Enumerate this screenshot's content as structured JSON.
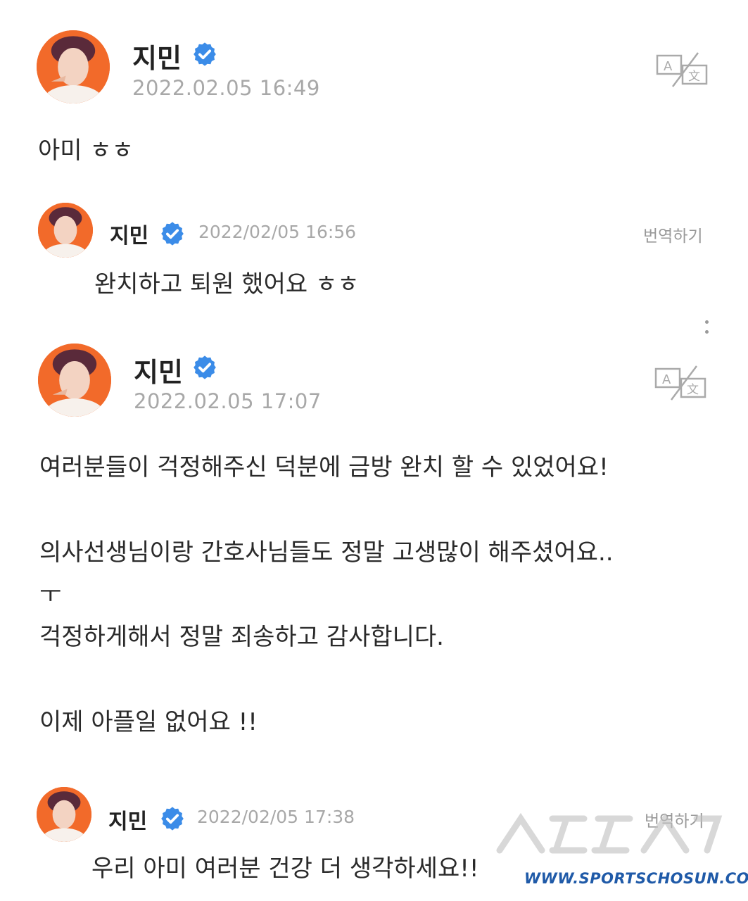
{
  "posts": [
    {
      "author": "지민",
      "date": "2022.02.05 16:49",
      "body": "아미 ㅎㅎ"
    },
    {
      "author": "지민",
      "date": "2022.02.05 17:07",
      "body_lines": [
        "여러분들이 걱정해주신 덕분에 금방 완치 할 수 있었어요!",
        "의사선생님이랑 간호사님들도 정말 고생많이 해주셨어요..",
        "ㅜ",
        "걱정하게해서 정말 죄송하고 감사합니다.",
        "이제 아플일 없어요 !!"
      ]
    }
  ],
  "comments": [
    {
      "author": "지민",
      "date": "2022/02/05 16:56",
      "translate_label": "번역하기",
      "body": "완치하고 퇴원 했어요 ㅎㅎ"
    },
    {
      "author": "지민",
      "date": "2022/02/05 17:38",
      "translate_label": "번역하기",
      "body": "우리 아미 여러분 건강 더 생각하세요!!"
    }
  ],
  "watermark": {
    "url": "WWW.SPORTSCHOSUN.COM"
  },
  "colors": {
    "verified": "#3b8ce8",
    "avatar_bg": "#f36b2c",
    "muted_text": "#a8a8a8"
  },
  "icons": {
    "verified": "verified-badge-icon",
    "translate": "translate-icon",
    "more": "more-vertical-icon"
  }
}
